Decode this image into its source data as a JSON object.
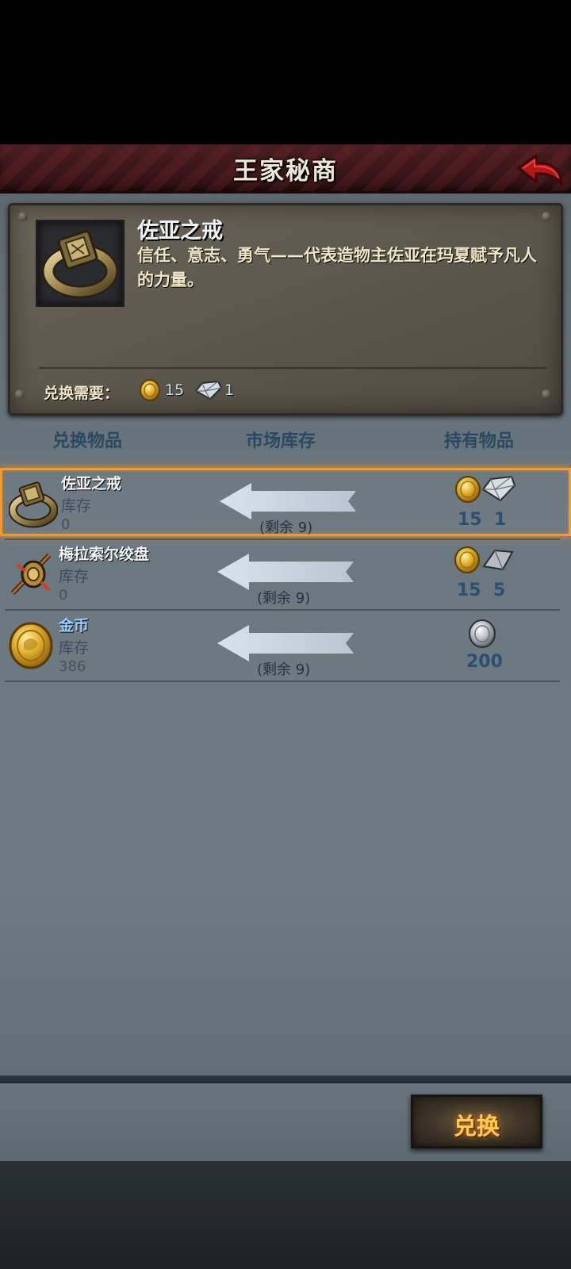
{
  "header": {
    "title": "王家秘商"
  },
  "detail": {
    "name": "佐亚之戒",
    "description": "信任、意志、勇气——代表造物主佐亚在玛夏赋予凡人的力量。",
    "requirement_label": "兑换需要：",
    "cost_gold": "15",
    "cost_diamond": "1",
    "icon": "ring-icon"
  },
  "columns": {
    "exchange_item": "兑换物品",
    "market_stock": "市场库存",
    "held_items": "持有物品"
  },
  "rows": [
    {
      "name": "佐亚之戒",
      "stock_label": "库存",
      "stock_value": "0",
      "remaining": "(剩余 9)",
      "icon": "ring-icon",
      "selected": true,
      "costs": [
        {
          "icon": "gold-coin-icon",
          "value": "15"
        },
        {
          "icon": "diamond-icon",
          "value": "1"
        }
      ]
    },
    {
      "name": "梅拉索尔绞盘",
      "stock_label": "库存",
      "stock_value": "0",
      "remaining": "(剩余 9)",
      "icon": "winch-icon",
      "selected": false,
      "costs": [
        {
          "icon": "gold-coin-icon",
          "value": "15"
        },
        {
          "icon": "iron-bar-icon",
          "value": "5"
        }
      ]
    },
    {
      "name": "金币",
      "stock_label": "库存",
      "stock_value": "386",
      "remaining": "(剩余 9)",
      "icon": "gold-coin-icon",
      "selected": false,
      "costs": [
        {
          "icon": "silver-coin-icon",
          "value": "200"
        }
      ]
    }
  ],
  "footer": {
    "exchange_button": "兑换"
  },
  "colors": {
    "accent_orange": "#f29a2e",
    "header_red": "#3a1519",
    "button_text": "#ffca5a"
  }
}
